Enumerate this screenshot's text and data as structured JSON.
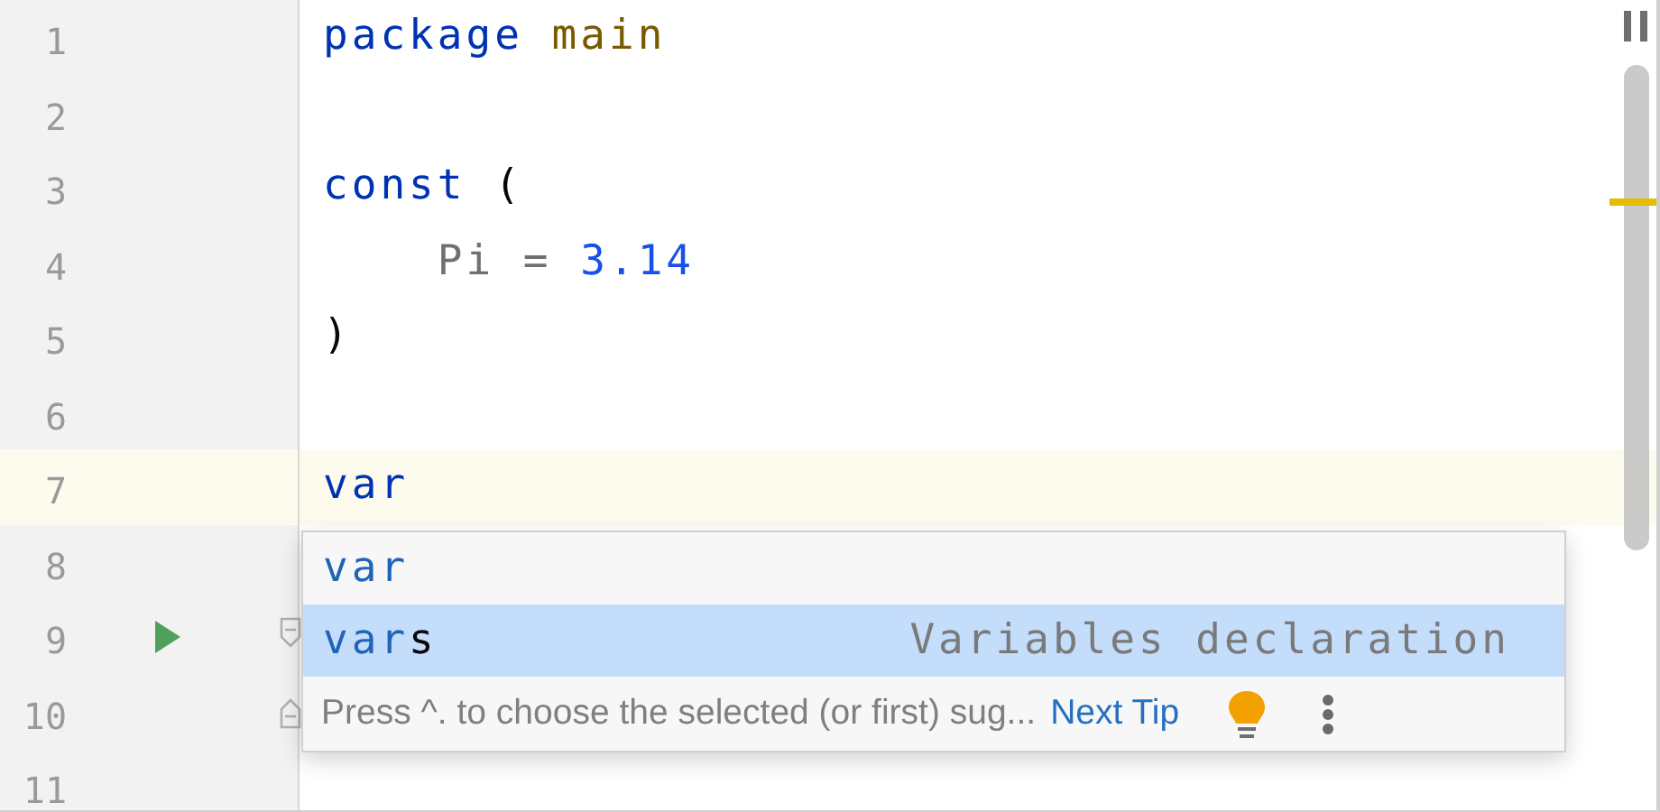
{
  "lines": [
    {
      "number": "1",
      "tokens": [
        {
          "text": "package",
          "kind": "keyword"
        },
        {
          "text": " main",
          "kind": "package"
        }
      ]
    },
    {
      "number": "2"
    },
    {
      "number": "3",
      "tokens": [
        {
          "text": "const",
          "kind": "keyword"
        },
        {
          "text": " (",
          "kind": "plain"
        }
      ]
    },
    {
      "number": "4",
      "tokens": [
        {
          "text": "    Pi = ",
          "kind": "constant"
        },
        {
          "text": "3.14",
          "kind": "number"
        }
      ]
    },
    {
      "number": "5",
      "tokens": [
        {
          "text": ")",
          "kind": "plain"
        }
      ]
    },
    {
      "number": "6"
    },
    {
      "number": "7",
      "current": true,
      "tokens": [
        {
          "text": "var",
          "kind": "keyword"
        }
      ]
    },
    {
      "number": "8"
    },
    {
      "number": "9",
      "run": true,
      "fold_start": true
    },
    {
      "number": "10",
      "fold_end": true
    },
    {
      "number": "11"
    }
  ],
  "completion": {
    "items": [
      {
        "match": "var",
        "selected": false
      },
      {
        "match": "var",
        "rest": "s",
        "type_text": "Variables declaration",
        "selected": true
      }
    ],
    "hint": "Press ^. to choose the selected (or first) sug...",
    "link": "Next Tip"
  }
}
